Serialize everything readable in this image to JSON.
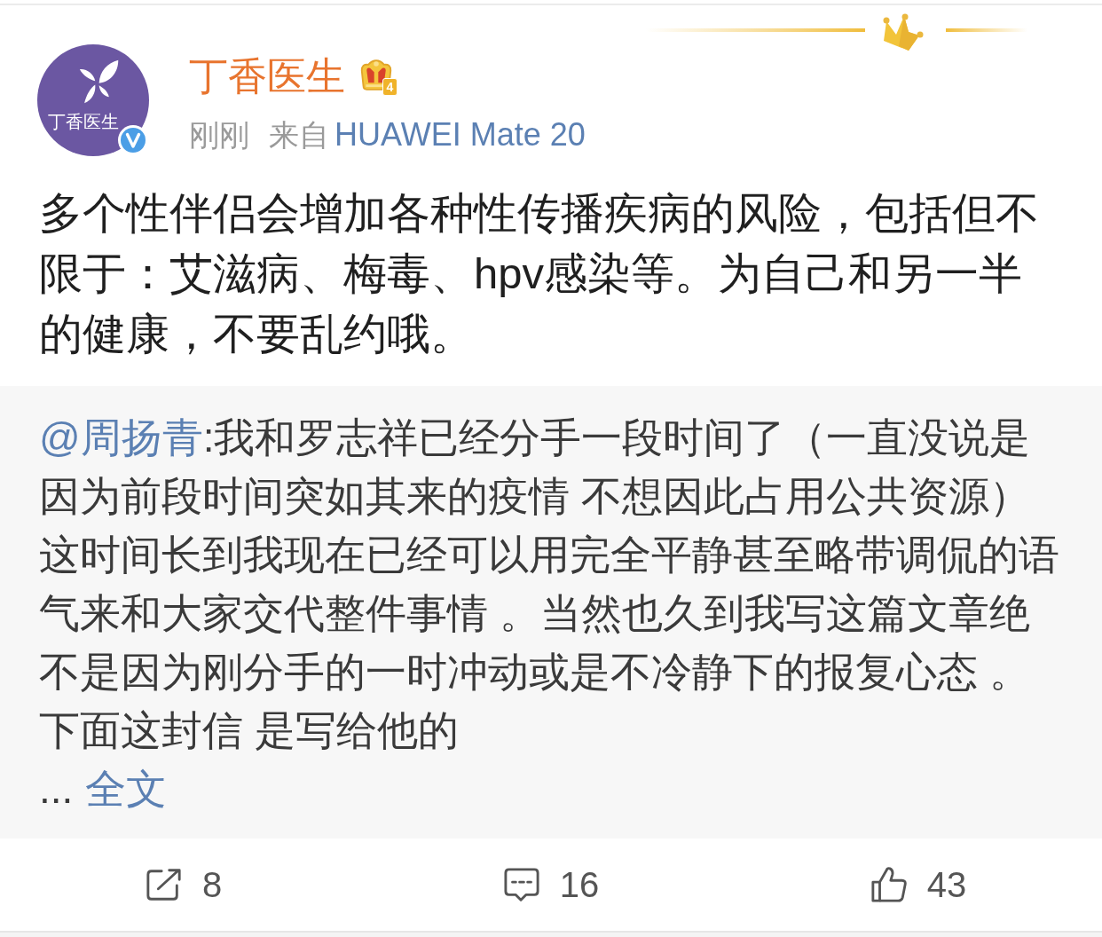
{
  "post": {
    "author": {
      "name": "丁香医生",
      "avatar_text": "丁香医生",
      "verified": true,
      "member_level": "4"
    },
    "time": "刚刚",
    "source_prefix": "来自",
    "source": "HUAWEI Mate 20",
    "text": "多个性伴侣会增加各种性传播疾病的风险，包括但不限于：艾滋病、梅毒、hpv感染等。为自己和另一半的健康，不要乱约哦。"
  },
  "retweeted": {
    "mention": "@周扬青",
    "paragraphs": [
      ":我和罗志祥已经分手一段时间了（一直没说是因为前段时间突如其来的疫情 不想因此占用公共资源）这时间长到我现在已经可以用完全平静甚至略带调侃的语气来和大家交代整件事情 。当然也久到我写这篇文章绝不是因为刚分手的一时冲动或是不冷静下的报复心态 。",
      "下面这封信 是写给他的"
    ],
    "ellipsis": "...",
    "more_link": "全文"
  },
  "actions": [
    {
      "kind": "repost",
      "count": "8"
    },
    {
      "kind": "comment",
      "count": "16"
    },
    {
      "kind": "like",
      "count": "43"
    }
  ]
}
